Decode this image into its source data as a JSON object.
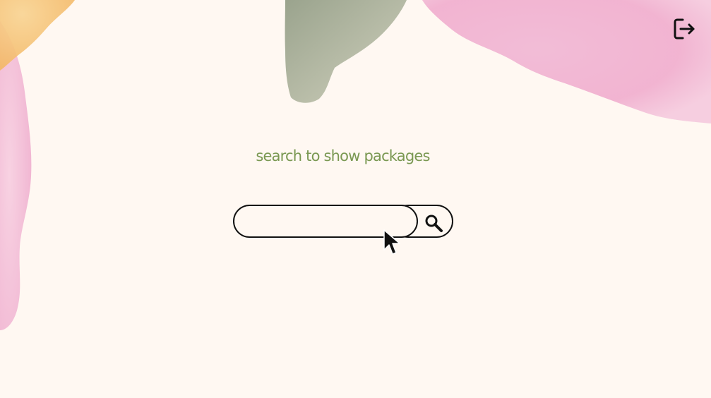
{
  "header": {
    "logout_icon": "logout-icon"
  },
  "main": {
    "prompt": "search to show packages",
    "search": {
      "value": "",
      "placeholder": "",
      "button_icon": "search-icon"
    }
  },
  "colors": {
    "background": "#fff8f2",
    "prompt_text": "#7a9852",
    "outline": "#111111",
    "pink_watercolor": "#ec9cc6",
    "orange_watercolor": "#f5c27c",
    "sage_watercolor": "#9fa48c"
  }
}
